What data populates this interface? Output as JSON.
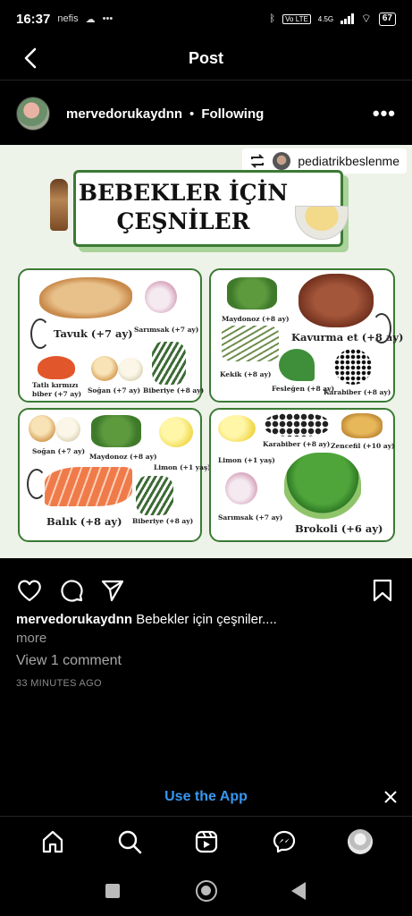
{
  "status_bar": {
    "time": "16:37",
    "app_icons": "nefis",
    "network": "4.5G",
    "volte": "Vo LTE",
    "battery": "67"
  },
  "header": {
    "title": "Post"
  },
  "post_author": {
    "username": "mervedorukaydnn",
    "separator": "•",
    "follow_state": "Following"
  },
  "repost": {
    "source_account": "pediatrikbeslenme"
  },
  "infographic": {
    "title_line1": "BEBEKLER İÇİN",
    "title_line2": "ÇEŞNİLER",
    "panels": [
      {
        "main": "Tavuk (+7 ay)",
        "items": [
          "Sarımsak (+7 ay)",
          "Tatlı kırmızı",
          "biber (+7 ay)",
          "Soğan (+7 ay)",
          "Biberiye (+8 ay)"
        ]
      },
      {
        "main": "Kavurma et (+8 ay)",
        "items": [
          "Maydonoz (+8 ay)",
          "Kekik (+8 ay)",
          "Fesleğen (+8 ay)",
          "Karabiber (+8 ay)"
        ]
      },
      {
        "main": "Balık (+8 ay)",
        "items": [
          "Soğan (+7 ay)",
          "Maydonoz (+8 ay)",
          "Limon (+1 yaş)",
          "Biberiye (+8 ay)"
        ]
      },
      {
        "main": "Brokoli (+6 ay)",
        "items": [
          "Limon (+1 yaş)",
          "Karabiber (+8 ay)",
          "Zencefil (+10 ay)",
          "Sarımsak (+7 ay)"
        ]
      }
    ]
  },
  "caption": {
    "username": "mervedorukaydnn",
    "text": "Bebekler için çeşniler....",
    "more": "more"
  },
  "comments_link": "View 1 comment",
  "timestamp": "33 MINUTES AGO",
  "use_app_banner": {
    "label": "Use the App"
  },
  "colors": {
    "accent_blue": "#3797f0",
    "panel_green": "#3b7a34"
  }
}
